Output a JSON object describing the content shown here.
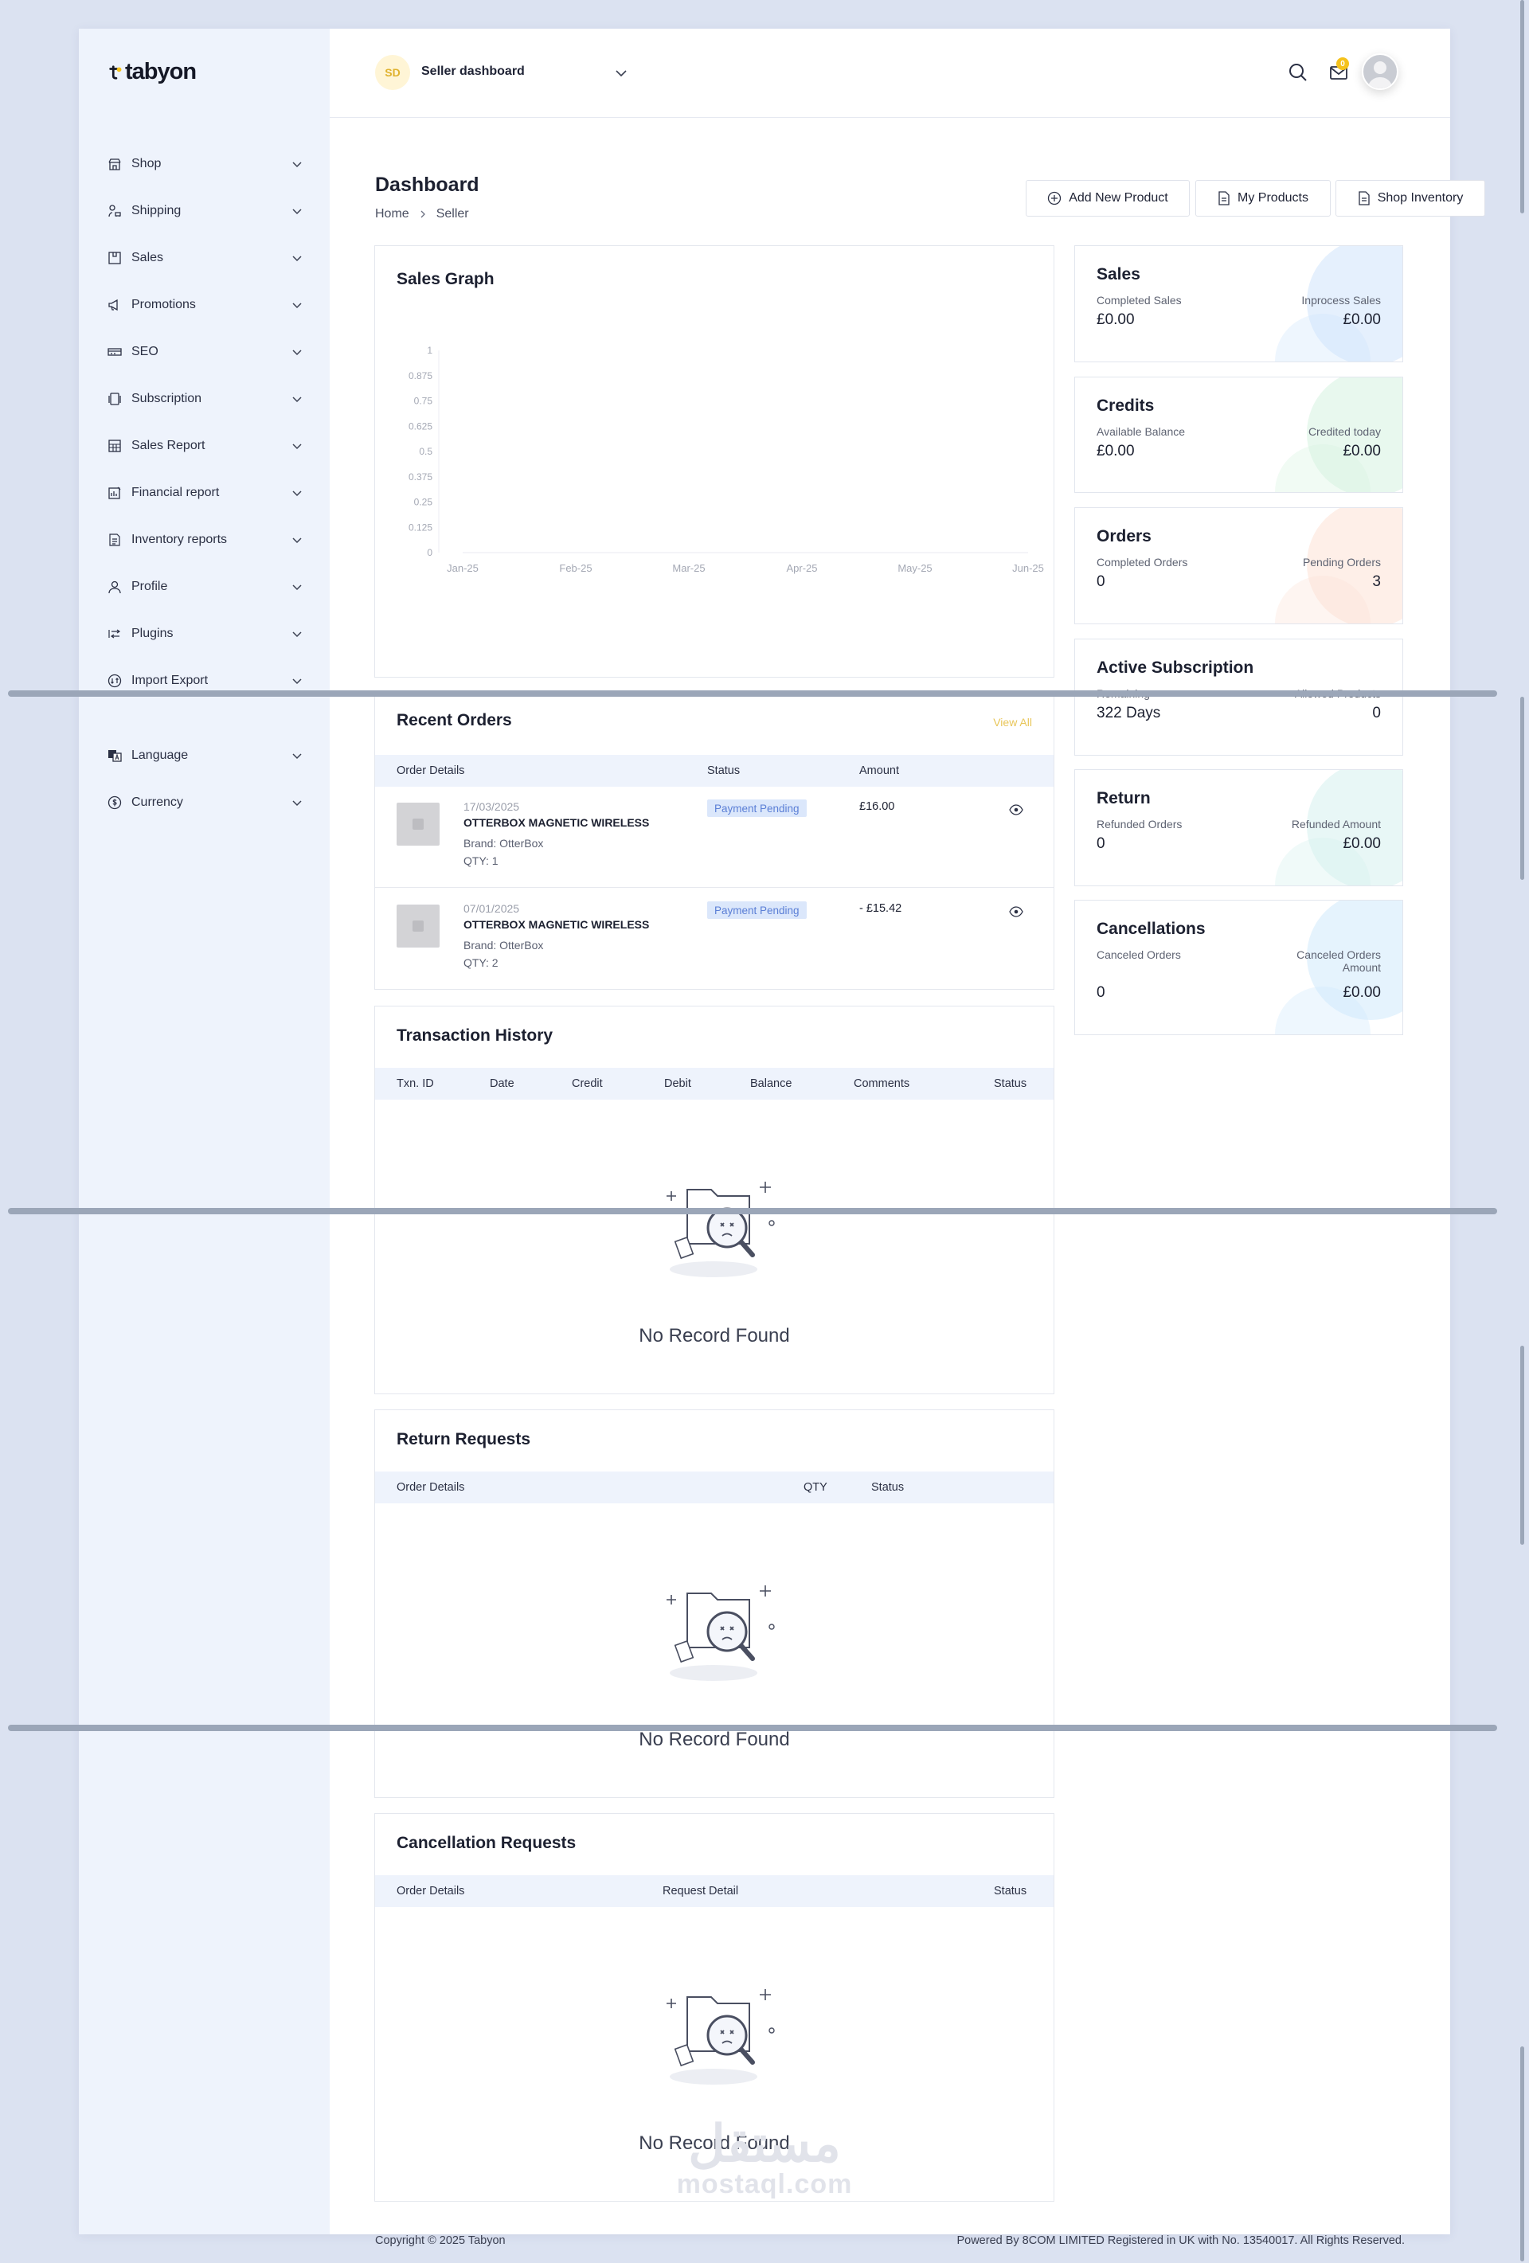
{
  "brand": {
    "name": "tabyon"
  },
  "sidebar": {
    "items": [
      {
        "label": "Shop",
        "icon": "shop-icon"
      },
      {
        "label": "Shipping",
        "icon": "truck-icon"
      },
      {
        "label": "Sales",
        "icon": "box-icon"
      },
      {
        "label": "Promotions",
        "icon": "megaphone-icon"
      },
      {
        "label": "SEO",
        "icon": "seo-icon"
      },
      {
        "label": "Subscription",
        "icon": "subscription-icon"
      },
      {
        "label": "Sales Report",
        "icon": "report-icon"
      },
      {
        "label": "Financial report",
        "icon": "finance-icon"
      },
      {
        "label": "Inventory reports",
        "icon": "inventory-icon"
      },
      {
        "label": "Profile",
        "icon": "user-icon"
      },
      {
        "label": "Plugins",
        "icon": "plugin-icon"
      },
      {
        "label": "Import Export",
        "icon": "import-export-icon"
      },
      {
        "label": "Language",
        "icon": "language-icon"
      },
      {
        "label": "Currency",
        "icon": "currency-icon"
      }
    ]
  },
  "header": {
    "badge": "SD",
    "dashboard_select": "Seller dashboard",
    "mail_count": "0"
  },
  "page": {
    "title": "Dashboard",
    "breadcrumb": [
      "Home",
      "Seller"
    ],
    "actions": {
      "add_product": "Add New Product",
      "my_products": "My Products",
      "shop_inventory": "Shop Inventory"
    }
  },
  "sales_graph": {
    "title": "Sales Graph"
  },
  "chart_data": {
    "type": "line",
    "title": "Sales Graph",
    "categories": [
      "Jan-25",
      "Feb-25",
      "Mar-25",
      "Apr-25",
      "May-25",
      "Jun-25"
    ],
    "y_ticks": [
      "0",
      "0.125",
      "0.25",
      "0.375",
      "0.5",
      "0.625",
      "0.75",
      "0.875",
      "1"
    ],
    "ylim": [
      0,
      1
    ],
    "series": [
      {
        "values": [
          0,
          0,
          0,
          0,
          0,
          0
        ]
      }
    ],
    "grid": false
  },
  "recent_orders": {
    "title": "Recent Orders",
    "view_all": "View All",
    "columns": [
      "Order Details",
      "Status",
      "Amount"
    ],
    "rows": [
      {
        "date": "17/03/2025",
        "name": "OTTERBOX MAGNETIC WIRELESS",
        "brand": "Brand: OtterBox",
        "qty": "QTY: 1",
        "status": "Payment Pending",
        "amount": "£16.00"
      },
      {
        "date": "07/01/2025",
        "name": "OTTERBOX MAGNETIC WIRELESS",
        "brand": "Brand: OtterBox",
        "qty": "QTY: 2",
        "status": "Payment Pending",
        "amount": "- £15.42"
      }
    ]
  },
  "transaction_history": {
    "title": "Transaction History",
    "columns": [
      "Txn. ID",
      "Date",
      "Credit",
      "Debit",
      "Balance",
      "Comments",
      "Status"
    ],
    "empty": "No Record Found"
  },
  "return_requests": {
    "title": "Return Requests",
    "columns": [
      "Order Details",
      "QTY",
      "Status"
    ],
    "empty": "No Record Found"
  },
  "cancellation_requests": {
    "title": "Cancellation Requests",
    "columns": [
      "Order Details",
      "Request Detail",
      "Status"
    ],
    "empty": "No Record Found"
  },
  "stats": {
    "sales": {
      "title": "Sales",
      "left_label": "Completed Sales",
      "left_value": "£0.00",
      "right_label": "Inprocess Sales",
      "right_value": "£0.00",
      "color": "#cfe4fb"
    },
    "credits": {
      "title": "Credits",
      "left_label": "Available Balance",
      "left_value": "£0.00",
      "right_label": "Credited today",
      "right_value": "£0.00",
      "color": "#d6f3e0"
    },
    "orders": {
      "title": "Orders",
      "left_label": "Completed Orders",
      "left_value": "0",
      "right_label": "Pending Orders",
      "right_value": "3",
      "color": "#fde2d6"
    },
    "subscription": {
      "title": "Active Subscription",
      "left_label": "Remaining",
      "left_value": "322 Days",
      "right_label": "Allowed Products",
      "right_value": "0",
      "color": "#ffffff"
    },
    "return": {
      "title": "Return",
      "left_label": "Refunded Orders",
      "left_value": "0",
      "right_label": "Refunded Amount",
      "right_value": "£0.00",
      "color": "#d5f1ee"
    },
    "cancellations": {
      "title": "Cancellations",
      "left_label": "Canceled Orders",
      "left_value": "0",
      "right_label": "Canceled Orders Amount",
      "right_value": "£0.00",
      "color": "#cfe9fb"
    }
  },
  "footer": {
    "copyright": "Copyright © 2025 Tabyon",
    "powered": "Powered By 8COM LIMITED Registered in UK with No. 13540017. All Rights Reserved."
  },
  "watermark": {
    "arabic": "مستقل",
    "latin": "mostaql.com"
  }
}
